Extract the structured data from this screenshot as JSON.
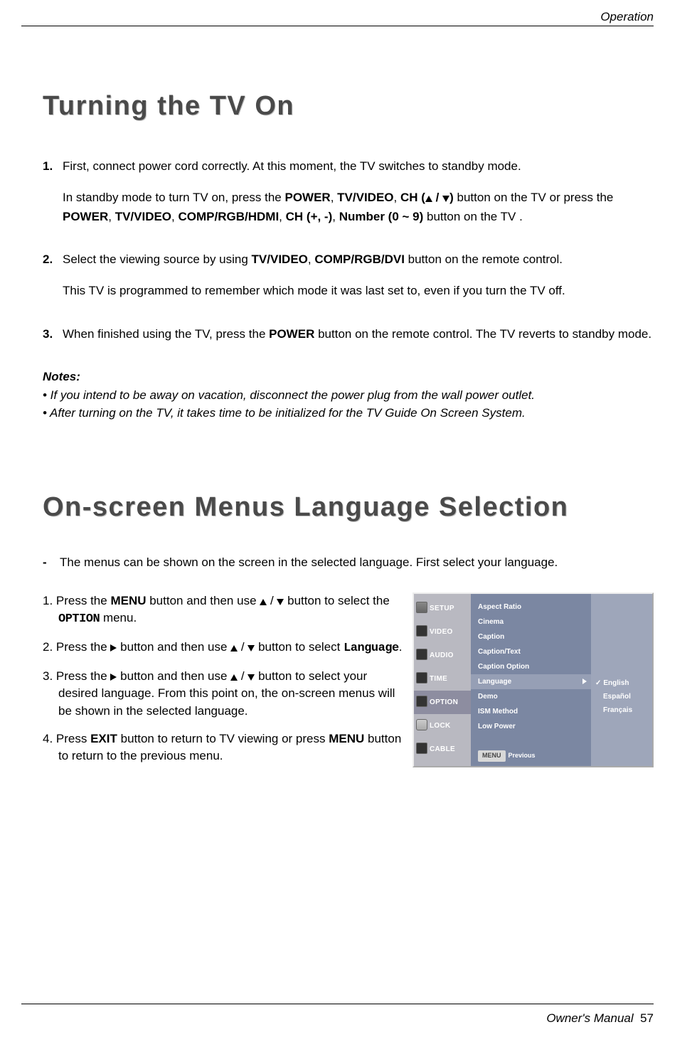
{
  "header": {
    "section": "Operation"
  },
  "footer": {
    "label": "Owner's Manual",
    "page": "57"
  },
  "title1": "Turning the TV On",
  "steps1": [
    {
      "num": "1.",
      "p1a": "First, connect power cord correctly. At this moment, the TV switches to standby mode.",
      "p2a": "In standby mode to turn TV on, press the ",
      "p2b": "POWER",
      "p2c": ", ",
      "p2d": "TV/VIDEO",
      "p2e": ", ",
      "p2f": "CH (",
      "p2g": " / ",
      "p2h": ")",
      "p2i": " button on the TV or press the ",
      "p2j": "POWER",
      "p2k": ", ",
      "p2l": "TV/VIDEO",
      "p2m": ", ",
      "p2n": "COMP/RGB/HDMI",
      "p2o": ", ",
      "p2p": "CH (+,  -)",
      "p2q": ", ",
      "p2r": "Number (0 ~ 9)",
      "p2s": " button on the TV ."
    },
    {
      "num": "2.",
      "p1a": "Select the viewing source by using ",
      "p1b": "TV/VIDEO",
      "p1c": ", ",
      "p1d": "COMP/RGB/DVI",
      "p1e": "  button on the remote control.",
      "p2a": "This TV is programmed to remember which mode it was last set to, even if you turn the TV off."
    },
    {
      "num": "3.",
      "p1a": "When finished using the TV, press the ",
      "p1b": "POWER",
      "p1c": " button on the remote control. The TV reverts to standby mode."
    }
  ],
  "notes": {
    "heading": "Notes:",
    "line1": "• If you intend to be away on vacation, disconnect the power plug from the wall power outlet.",
    "line2": "• After turning on the TV, it takes time to be initialized for the TV Guide On Screen System."
  },
  "title2": "On-screen Menus Language Selection",
  "intro2": {
    "dash": "-",
    "text": "The menus can be shown on the screen in the selected language. First select your language."
  },
  "steps2": [
    {
      "a": "1. Press the ",
      "b": "MENU",
      "c": " button and then use ",
      "d": " / ",
      "e": " button to select the ",
      "f": "OPTION",
      "g": " menu."
    },
    {
      "a": "2. Press the ",
      "c": " button and then use ",
      "d": " / ",
      "e": " button to select ",
      "f": "Language",
      "g": "."
    },
    {
      "a": "3. Press the ",
      "c": " button and then use ",
      "d": " / ",
      "e": " button to select your desired language. From this point on, the on-screen menus will be shown in the selected language."
    },
    {
      "a": "4. Press ",
      "b": "EXIT",
      "c": " button to return to TV viewing or press ",
      "d": "MENU",
      "e": " button to return to the previous menu."
    }
  ],
  "osd": {
    "tabs": [
      "SETUP",
      "VIDEO",
      "AUDIO",
      "TIME",
      "OPTION",
      "LOCK",
      "CABLE"
    ],
    "items": [
      "Aspect Ratio",
      "Cinema",
      "Caption",
      "Caption/Text",
      "Caption Option",
      "Language",
      "Demo",
      "ISM Method",
      "Low Power"
    ],
    "options": [
      "English",
      "Español",
      "Français"
    ],
    "menubar": {
      "btn": "MENU",
      "label": "Previous"
    },
    "arrow": "G"
  }
}
